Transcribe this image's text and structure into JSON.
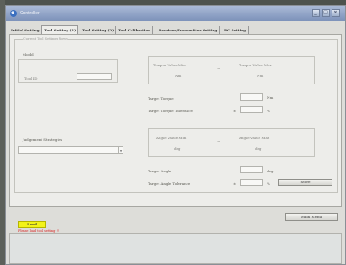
{
  "window": {
    "title": "Controller"
  },
  "titlebar": {
    "minimize_glyph": "_",
    "maximize_glyph": "□",
    "close_glyph": "✕"
  },
  "tabs": [
    {
      "label": "Initial Setting"
    },
    {
      "label": "Tool Setting (1)",
      "active": true
    },
    {
      "label": "Tool Setting (2)"
    },
    {
      "label": "Tool Calibration"
    },
    {
      "label": "Receiver/Transmitter Setting"
    },
    {
      "label": "PC Setting"
    }
  ],
  "current_settings": {
    "group_title": "Current Tool Settings Rows",
    "model_label": "Model",
    "tool_id_label": "Tool ID",
    "tool_id_value": "",
    "judgement_label": "Judgement Strategies",
    "judgement_value": ""
  },
  "torque_range": {
    "min_label": "Torque Value Min",
    "min_unit": "Nm",
    "separator": "~",
    "max_label": "Torque Value Max",
    "max_unit": "Nm"
  },
  "torque_settings": {
    "target_label": "Target Torque",
    "target_value": "",
    "target_unit": "Nm",
    "tolerance_label": "Target Torque Tolerance",
    "tolerance_sign": "±",
    "tolerance_value": "",
    "tolerance_unit": "%"
  },
  "angle_range": {
    "min_label": "Angle Value Min",
    "min_unit": "deg",
    "separator": "~",
    "max_label": "Angle Value Max",
    "max_unit": "deg"
  },
  "angle_settings": {
    "target_label": "Target Angle",
    "target_value": "",
    "target_unit": "deg",
    "tolerance_label": "Target Angle Tolerance",
    "tolerance_sign": "±",
    "tolerance_value": "",
    "tolerance_unit": "%"
  },
  "actions": {
    "store_label": "Store",
    "load_label": "Load",
    "main_menu_label": "Main Menu"
  },
  "status": {
    "warning": "Please load tool setting !!"
  },
  "colors": {
    "load_button": "#f3f31a",
    "warning_text": "#d81e1e",
    "title_bar": "#7d92ba"
  }
}
